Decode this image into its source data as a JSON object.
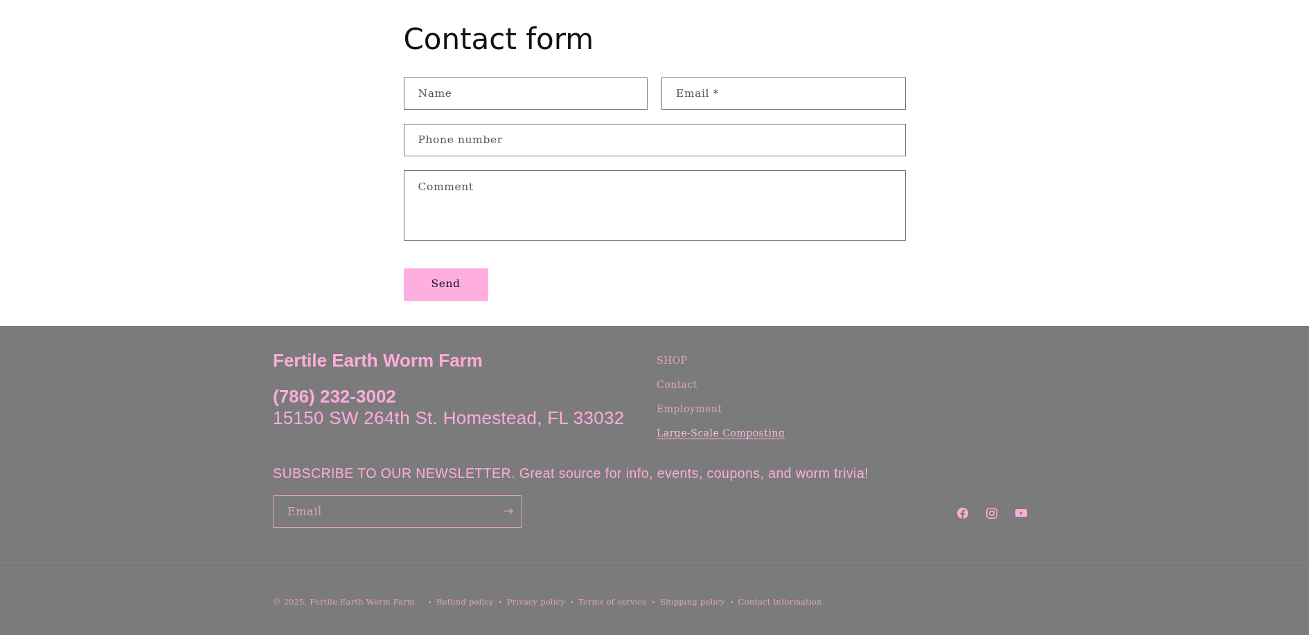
{
  "contact_form": {
    "title": "Contact form",
    "rows": [
      {
        "fields": [
          {
            "kind": "input",
            "placeholder": "Name"
          },
          {
            "kind": "input",
            "placeholder": "Email *"
          }
        ]
      },
      {
        "fields": [
          {
            "kind": "input",
            "placeholder": "Phone number"
          }
        ]
      },
      {
        "fields": [
          {
            "kind": "textarea",
            "placeholder": "Comment"
          }
        ]
      }
    ],
    "submit_label": "Send"
  },
  "footer": {
    "brand": "Fertile Earth Worm Farm",
    "phone": "(786) 232-3002",
    "address": "15150 SW 264th St. Homestead, FL 33032",
    "links": [
      {
        "label": "SHOP",
        "current": false
      },
      {
        "label": "Contact",
        "current": false
      },
      {
        "label": "Employment",
        "current": false
      },
      {
        "label": "Large-Scale Composting",
        "current": true
      }
    ],
    "newsletter": {
      "heading": "SUBSCRIBE TO OUR NEWSLETTER. Great source for info, events, coupons, and worm trivia!",
      "placeholder": "Email"
    }
  },
  "bottom_bar": {
    "copyright": "© 2025, Fertile Earth Worm Farm",
    "policies": [
      "Refund policy",
      "Privacy policy",
      "Terms of service",
      "Shipping policy",
      "Contact information"
    ]
  }
}
